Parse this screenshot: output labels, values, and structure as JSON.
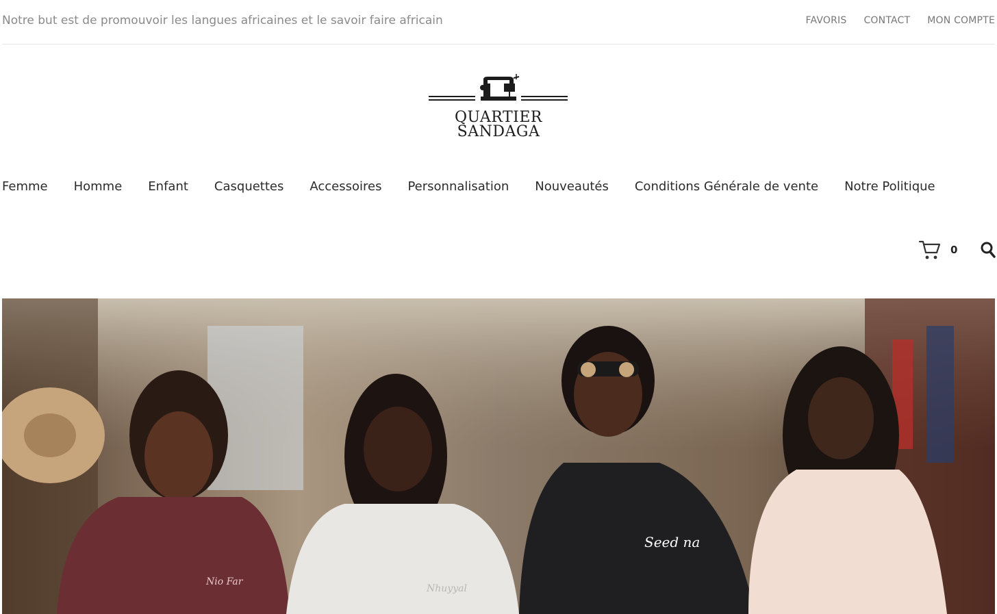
{
  "topbar": {
    "tagline": "Notre but est de promouvoir les langues africaines et le savoir faire africain",
    "links": [
      "FAVORIS",
      "CONTACT",
      "MON COMPTE"
    ]
  },
  "logo": {
    "line1": "QUARTIER",
    "line2": "SANDAGA",
    "icon": "sewing-machine-icon"
  },
  "nav": {
    "items": [
      "Femme",
      "Homme",
      "Enfant",
      "Casquettes",
      "Accessoires",
      "Personnalisation",
      "Nouveautés",
      "Conditions Générale de vente",
      "Notre Politique"
    ]
  },
  "cart": {
    "count": "0",
    "icon": "cart-icon"
  },
  "search": {
    "icon": "search-icon"
  },
  "hero": {
    "sweatshirt_texts": [
      "Seed na",
      "Nio Far",
      "Nhuyyal"
    ]
  },
  "colors": {
    "text": "#2b2b2b",
    "muted": "#8a8a8a",
    "border": "#e5e5e5"
  }
}
